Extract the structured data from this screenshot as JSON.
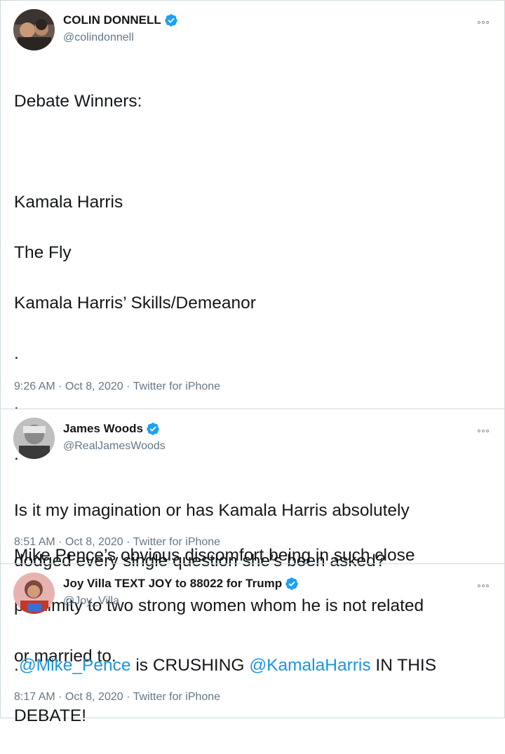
{
  "tweets": [
    {
      "name": "COLIN DONNELL",
      "handle": "@colindonnell",
      "lines": [
        "Debate Winners:",
        "",
        "Kamala Harris",
        "The Fly",
        "Kamala Harris’ Skills/Demeanor",
        ".",
        ".",
        ".",
        ".",
        "Mike Pence’s obvious discomfort being in such close",
        "proximity to two strong women whom he is not related",
        "or married to."
      ],
      "time": "9:26 AM",
      "date": "Oct 8, 2020",
      "source": "Twitter for iPhone"
    },
    {
      "name": "James Woods",
      "handle": "@RealJamesWoods",
      "lines": [
        "Is it my imagination or has Kamala Harris absolutely",
        "dodged every single question she’s been asked?"
      ],
      "time": "8:51 AM",
      "date": "Oct 8, 2020",
      "source": "Twitter for iPhone"
    },
    {
      "name": "Joy Villa TEXT JOY to 88022 for Trump",
      "handle": "@Joy_Villa",
      "line1": {
        "prefix": ".",
        "mention1": "@Mike_Pence",
        "middle": " is CRUSHING ",
        "mention2": "@KamalaHarris",
        "suffix": " IN THIS"
      },
      "line2": "DEBATE!",
      "time": "8:17 AM",
      "date": "Oct 8, 2020",
      "source": "Twitter for iPhone"
    }
  ],
  "meta_separator": " · ",
  "colors": {
    "verified": "#1da1f2",
    "mention": "#1b95e0",
    "handle": "#657786"
  }
}
